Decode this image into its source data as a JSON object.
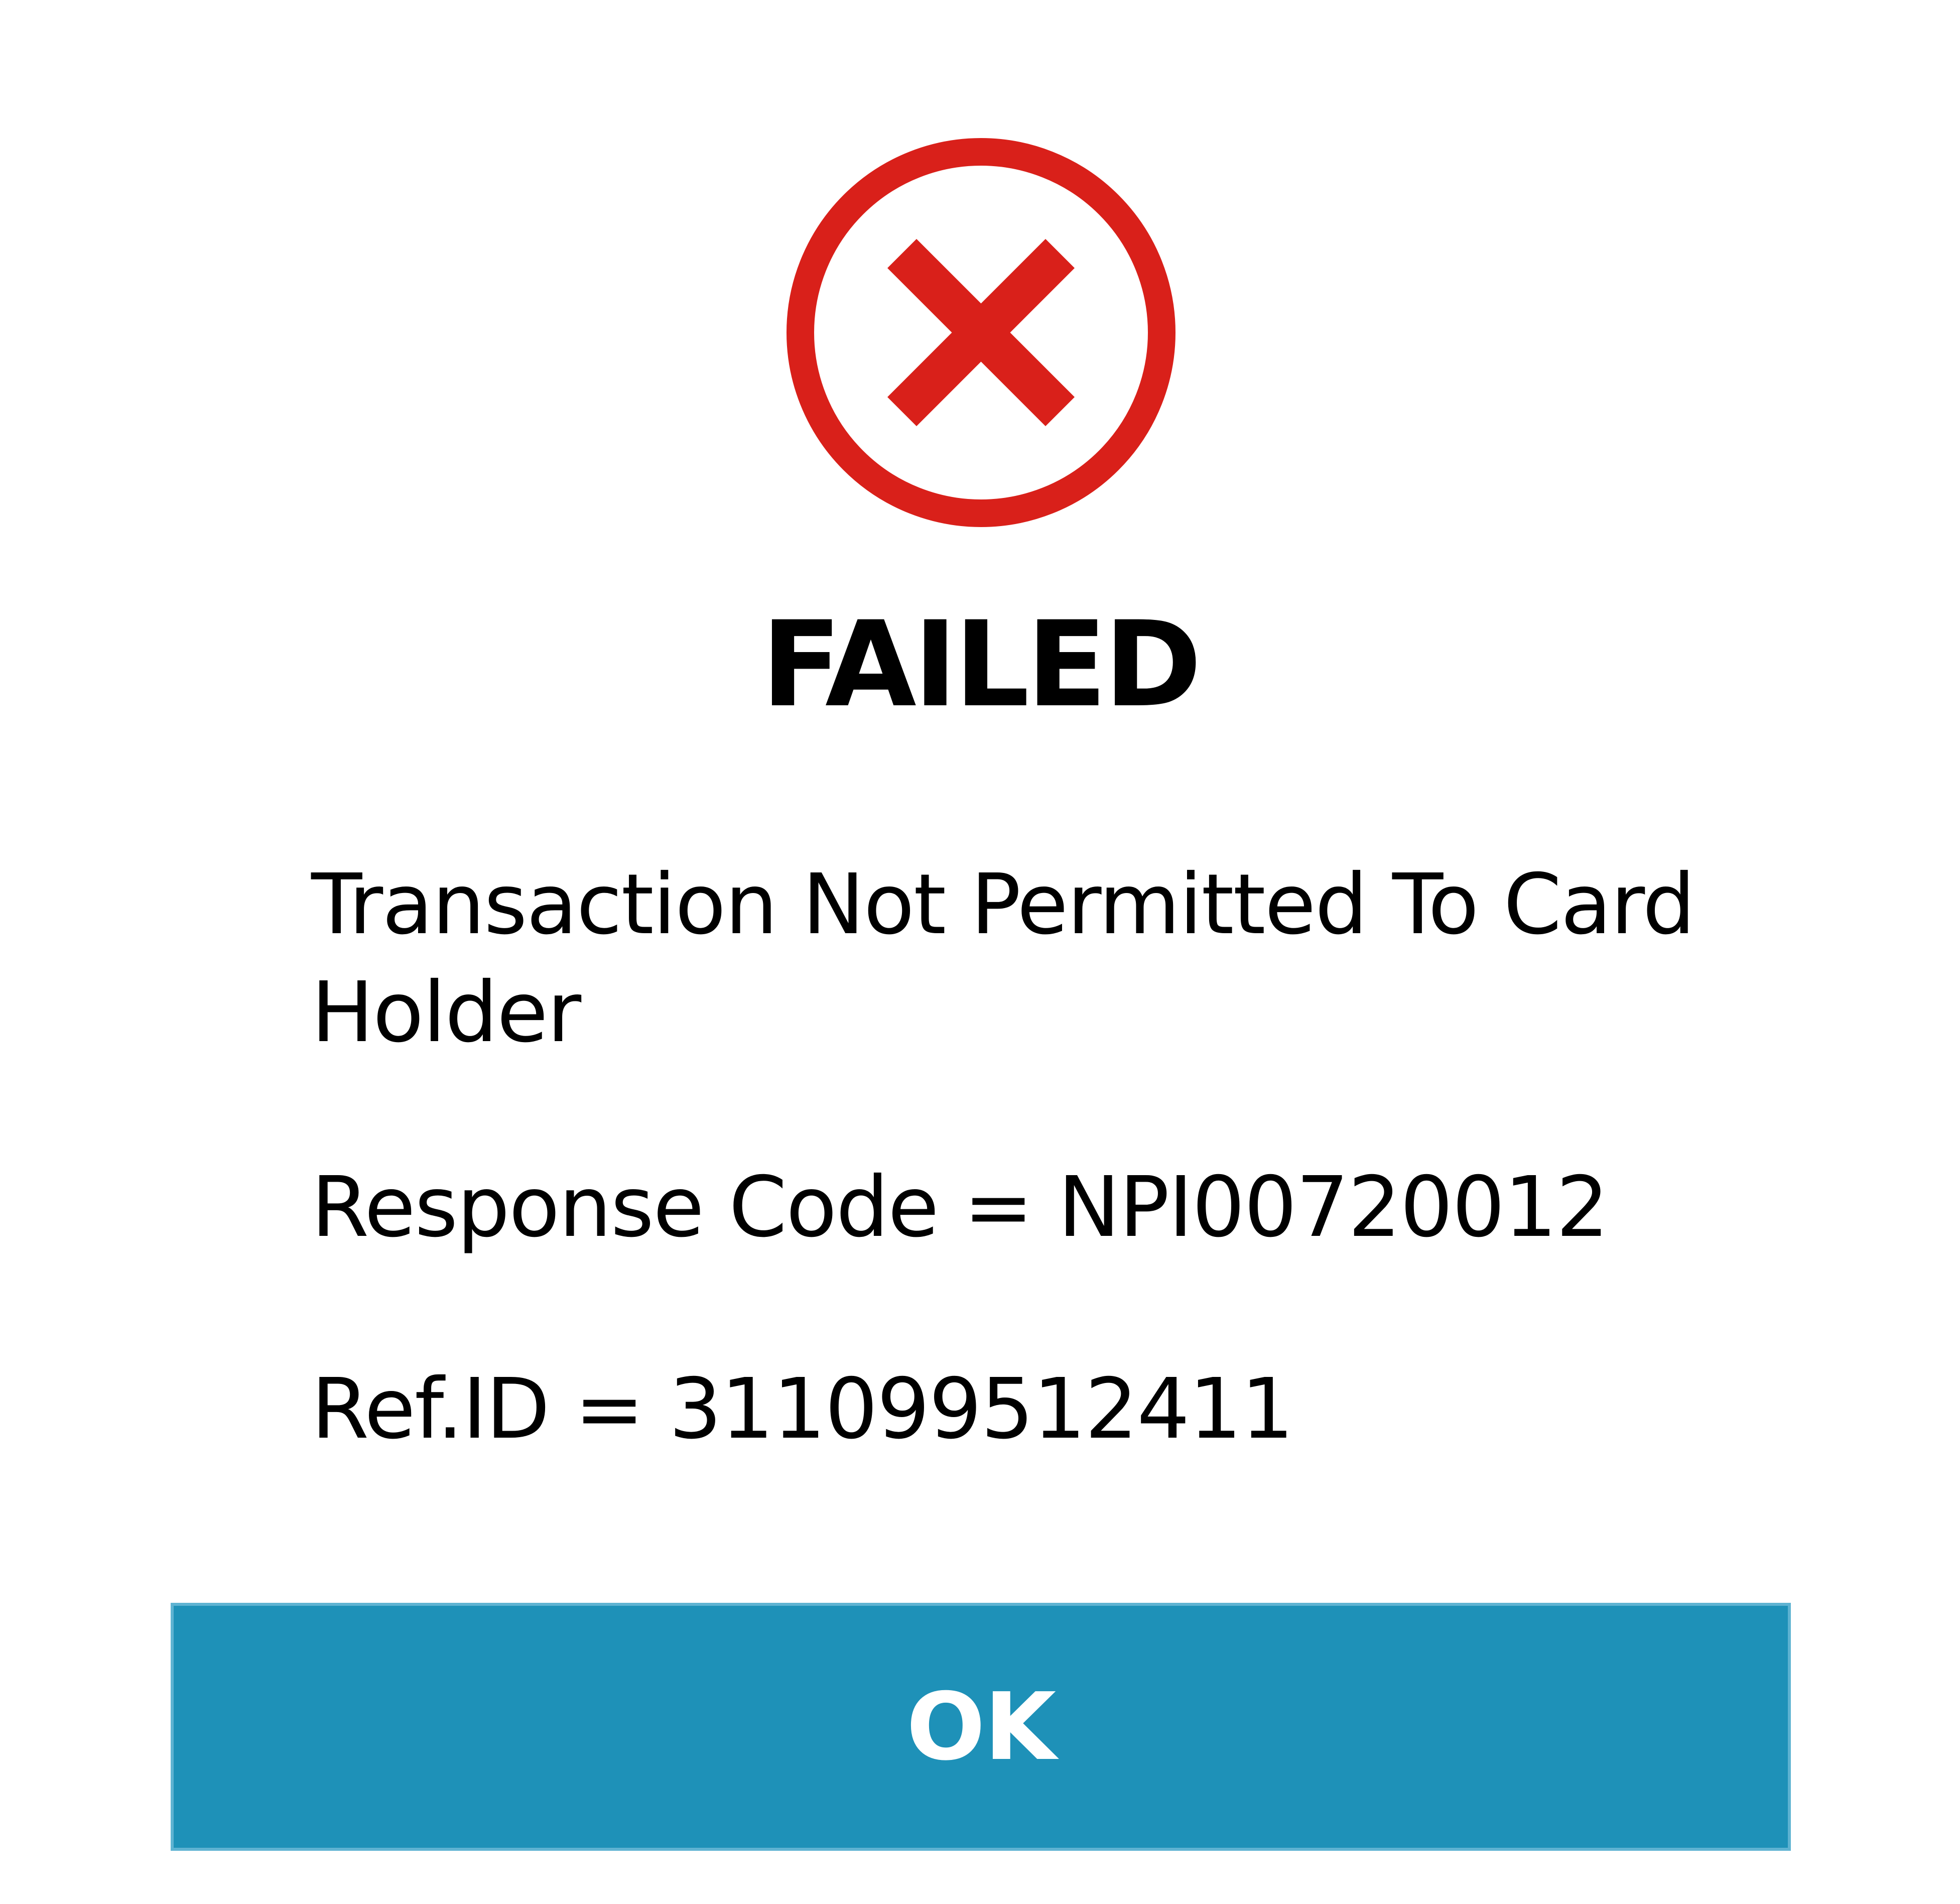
{
  "dialog": {
    "status_icon": "close-circle-icon",
    "title": "FAILED",
    "message": "Transaction Not Permitted To Card Holder",
    "response_code": "Response Code = NPI00720012",
    "ref_id": "Ref.ID = 311099512411",
    "ok_label": "OK"
  },
  "colors": {
    "error_red": "#d9201a",
    "button_blue": "#1e91b8",
    "button_text": "#ffffff",
    "text": "#000000",
    "background": "#ffffff"
  }
}
